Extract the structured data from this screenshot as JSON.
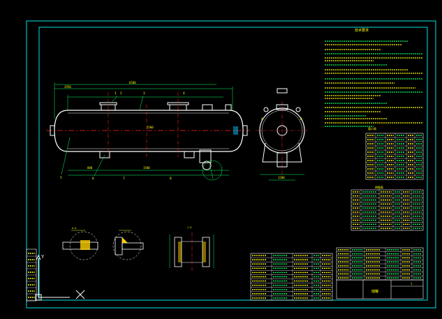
{
  "colors": {
    "background": "#000000",
    "border": "#00e5e5",
    "outline": "#ffffff",
    "center_line": "#ff2020",
    "dimension": "#00ff66",
    "text": "#ffff00",
    "hatch": "#ffd000",
    "cyan_text": "#00ffff"
  },
  "front_view": {
    "dims_top": [
      "2950",
      "6500"
    ],
    "dims_bottom": [
      "880",
      "1500"
    ],
    "dims_mid": [
      "2500"
    ],
    "part_labels": [
      "1",
      "2",
      "3",
      "4",
      "5",
      "6",
      "7",
      "8"
    ]
  },
  "side_view": {
    "labels": [
      "A",
      "B"
    ],
    "dims": [
      "1200"
    ]
  },
  "details": {
    "caption": "A-A",
    "nozzle_caption": "1:5"
  },
  "notes": {
    "title": "技术要求"
  },
  "tables": {
    "nozzle_title": "管口表",
    "parts_title": "明细表"
  },
  "title_block": {
    "name": "储罐",
    "sheet": "1"
  },
  "icons": {
    "ucs": "ucs-axis-icon",
    "cursor": "crosshair-icon"
  }
}
